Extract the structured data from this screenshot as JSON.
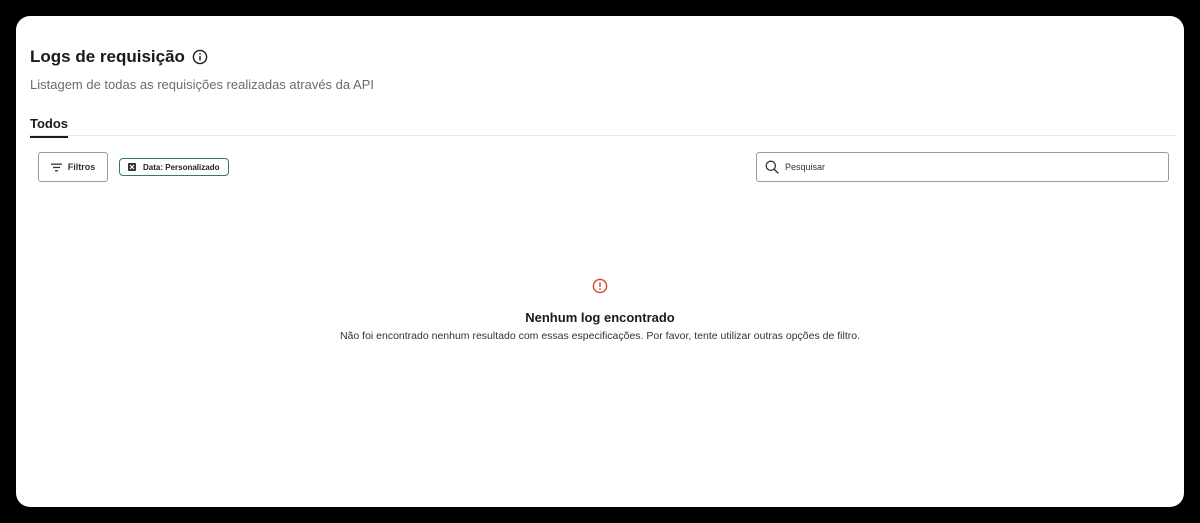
{
  "header": {
    "title": "Logs de requisição",
    "subtitle": "Listagem de todas as requisições realizadas através da API",
    "info_icon": "info-circle-icon"
  },
  "tabs": [
    {
      "label": "Todos",
      "active": true
    }
  ],
  "toolbar": {
    "filters_label": "Filtros",
    "filters_icon": "filter-icon",
    "chip_label": "Data: Personalizado",
    "chip_icon": "close-icon",
    "search_placeholder": "Pesquisar",
    "search_value": "",
    "search_icon": "search-icon"
  },
  "empty_state": {
    "icon": "alert-circle-icon",
    "title": "Nenhum log encontrado",
    "message": "Não foi encontrado nenhum resultado com essas especificações. Por favor, tente utilizar outras opções de filtro."
  },
  "colors": {
    "background": "#000000",
    "card": "#ffffff",
    "accent_green": "#2e7d5b",
    "alert_red": "#d9432f"
  }
}
